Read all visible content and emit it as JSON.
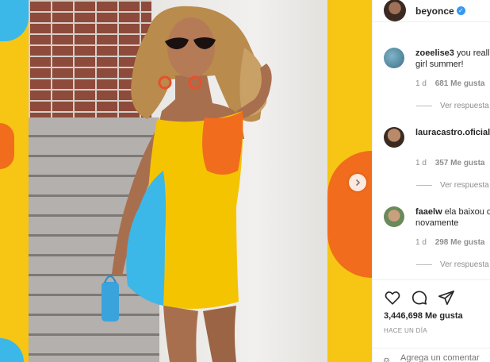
{
  "post": {
    "username": "beyonce",
    "verified_icon": "verified-badge-icon",
    "likes_text": "3,446,698 Me gusta",
    "timestamp": "HACE UN DÍA"
  },
  "comments": [
    {
      "username": "zoeelise3",
      "text": "you reall",
      "text_line2": "girl summer!",
      "age": "1 d",
      "likes": "681 Me gusta",
      "replies": "Ver respuesta"
    },
    {
      "username": "lauracastro.oficial",
      "text": "",
      "text_line2": "",
      "age": "1 d",
      "likes": "357 Me gusta",
      "replies": "Ver respuesta"
    },
    {
      "username": "faaelw",
      "text": "ela baixou d",
      "text_line2": "novamente",
      "age": "1 d",
      "likes": "298 Me gusta",
      "replies": "Ver respuesta"
    }
  ],
  "add_comment": {
    "placeholder": "Agrega un comentar"
  },
  "colors": {
    "accent_blue": "#3897f0",
    "dress_yellow": "#f5c400",
    "dress_orange": "#f26c1d",
    "dress_blue": "#3bb7e8"
  },
  "icons": {
    "like": "heart-icon",
    "comment": "comment-bubble-icon",
    "share": "paper-plane-icon",
    "emoji": "emoji-icon",
    "next": "chevron-right-icon"
  }
}
